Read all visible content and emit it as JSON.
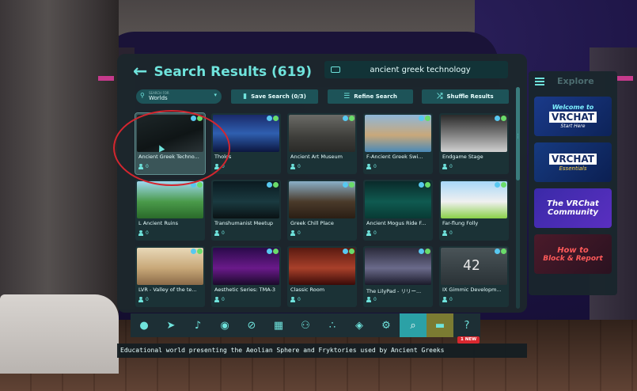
{
  "header": {
    "back_icon": "arrow-left-icon",
    "title": "Search Results (619)",
    "search_value": "ancient greek technology"
  },
  "toolbar": {
    "filter_small_label": "SEARCH FOR",
    "filter_value": "Worlds",
    "save_search": "Save Search (0/3)",
    "refine_search": "Refine Search",
    "shuffle_results": "Shuffle Results"
  },
  "worlds": [
    {
      "name": "Ancient Greek Techno...",
      "users": "0",
      "thumb": "dark"
    },
    {
      "name": "Tholos",
      "users": "0",
      "thumb": "blue"
    },
    {
      "name": "Ancient Art Museum",
      "users": "0",
      "thumb": "grey"
    },
    {
      "name": "F-Ancient Greek Swi...",
      "users": "0",
      "thumb": "pool"
    },
    {
      "name": "Endgame Stage",
      "users": "0",
      "thumb": "stage"
    },
    {
      "name": "L Ancient Ruins",
      "users": "0",
      "thumb": "green"
    },
    {
      "name": "Transhumanist Meetup",
      "users": "0",
      "thumb": "night"
    },
    {
      "name": "Greek Chill Place",
      "users": "0",
      "thumb": "temple"
    },
    {
      "name": "Ancient Mogus Ride F...",
      "users": "0",
      "thumb": "teal"
    },
    {
      "name": "Far-flung Folly",
      "users": "0",
      "thumb": "sky"
    },
    {
      "name": "LVR - Valley of the te...",
      "users": "0",
      "thumb": "sand"
    },
    {
      "name": "Aesthetic Series: TMA-3",
      "users": "0",
      "thumb": "purple"
    },
    {
      "name": "Classic Room",
      "users": "0",
      "thumb": "red"
    },
    {
      "name": "The LilyPad - リリー...",
      "users": "0",
      "thumb": "lily"
    },
    {
      "name": "IX Gimmic Developm...",
      "users": "0",
      "thumb": "slate",
      "overlay": "42"
    }
  ],
  "explore": {
    "title": "Explore",
    "promos": [
      {
        "line1": "Welcome to",
        "logo": "VRCHAT",
        "line3": "Start Here"
      },
      {
        "line1": "",
        "logo": "VRCHAT",
        "line3": "Essentials"
      },
      {
        "line1": "The VRChat",
        "logo": "",
        "line3": "Community"
      },
      {
        "line1": "How to",
        "logo": "",
        "line3": "Block & Report"
      }
    ]
  },
  "dock": {
    "icons": [
      "chat-bubble-icon",
      "rocket-icon",
      "bell-icon",
      "profile-icon",
      "avatar-icon",
      "worlds-icon",
      "social-icon",
      "groups-icon",
      "safety-icon",
      "settings-icon",
      "search-icon",
      "notice-icon",
      "help-icon"
    ],
    "new_badge": "1 NEW"
  },
  "status": {
    "description": "Educational world presenting the Aeolian Sphere and Fryktories used by Ancient Greeks"
  },
  "colors": {
    "accent": "#6fe3dc",
    "panel": "#1c262c",
    "button": "#1d5358",
    "highlight": "#d3262f"
  }
}
